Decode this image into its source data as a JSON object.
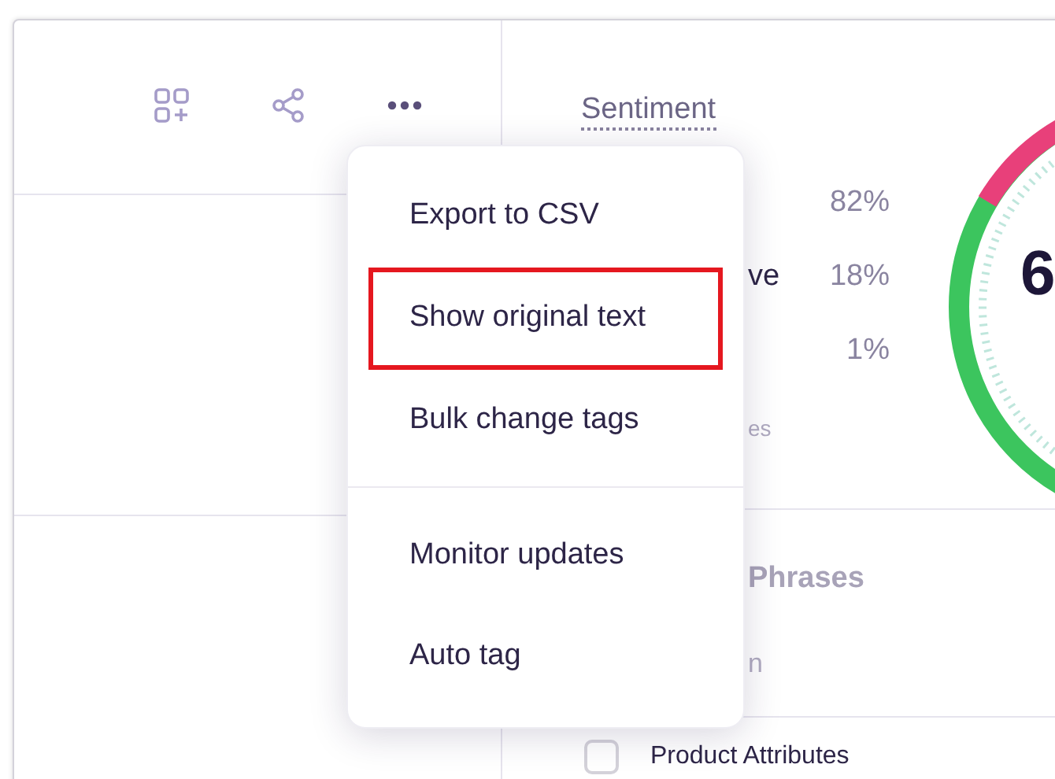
{
  "toolbar": {
    "buttons": [
      {
        "kind": "add-widget"
      },
      {
        "kind": "share"
      },
      {
        "kind": "more"
      }
    ]
  },
  "sentiment": {
    "title": "Sentiment",
    "rows": [
      {
        "label": "",
        "value": "82%"
      },
      {
        "label": "ve",
        "value": "18%"
      },
      {
        "label": "",
        "value": "1%"
      }
    ],
    "footnote": "es",
    "gauge_value": "6"
  },
  "phrases": {
    "title": "Phrases",
    "subtitle": "n",
    "items": [
      {
        "label": "Product Attributes",
        "checked": false
      }
    ]
  },
  "menu": {
    "sections": [
      {
        "items": [
          {
            "label": "Export to CSV",
            "highlighted": false
          },
          {
            "label": "Show original text",
            "highlighted": true
          },
          {
            "label": "Bulk change tags",
            "highlighted": false
          }
        ]
      },
      {
        "items": [
          {
            "label": "Monitor updates",
            "highlighted": false
          },
          {
            "label": "Auto tag",
            "highlighted": false
          }
        ]
      }
    ]
  }
}
